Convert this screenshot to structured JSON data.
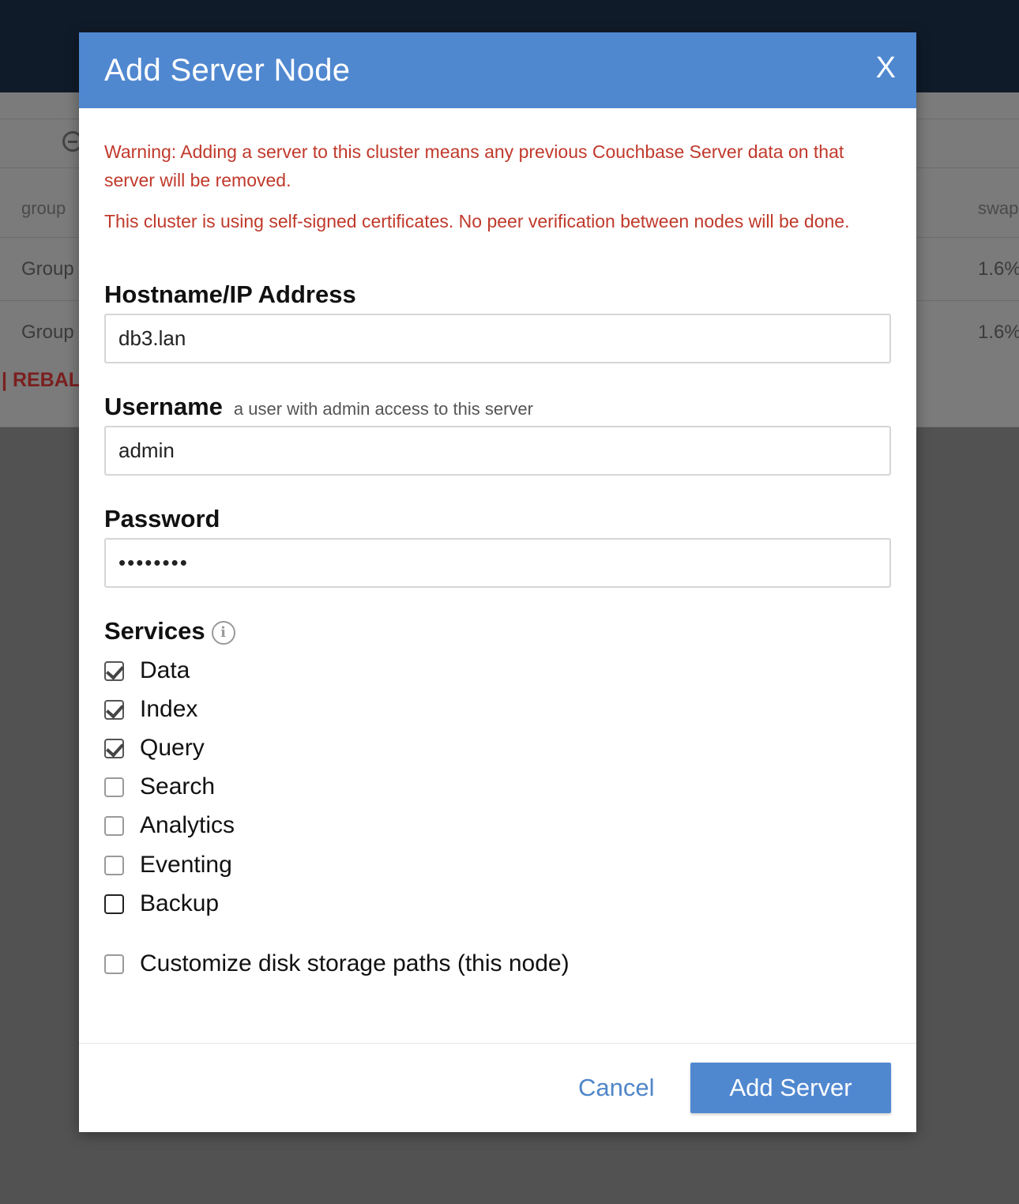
{
  "background": {
    "group_col_header": "group",
    "swap_col_header": "swap",
    "rows": [
      {
        "group": "Group",
        "swap": "1.6%"
      },
      {
        "group": "Group",
        "swap": "1.6%"
      }
    ],
    "rebalance_label": "| REBAL"
  },
  "modal": {
    "title": "Add Server Node",
    "close_label": "X",
    "warning_1": "Warning: Adding a server to this cluster means any previous Couchbase Server data on that server will be removed.",
    "warning_2": "This cluster is using self-signed certificates. No peer verification between nodes will be done.",
    "hostname": {
      "label": "Hostname/IP Address",
      "value": "db3.lan"
    },
    "username": {
      "label": "Username",
      "hint": "a user with admin access to this server",
      "value": "admin"
    },
    "password": {
      "label": "Password",
      "value": "••••••••"
    },
    "services": {
      "label": "Services",
      "info_icon": "info-icon",
      "items": [
        {
          "label": "Data",
          "checked": true
        },
        {
          "label": "Index",
          "checked": true
        },
        {
          "label": "Query",
          "checked": true
        },
        {
          "label": "Search",
          "checked": false
        },
        {
          "label": "Analytics",
          "checked": false
        },
        {
          "label": "Eventing",
          "checked": false
        },
        {
          "label": "Backup",
          "checked": false
        }
      ]
    },
    "customize_paths": {
      "label": "Customize disk storage paths (this node)",
      "checked": false
    },
    "cancel_label": "Cancel",
    "add_label": "Add Server"
  },
  "colors": {
    "header": "#5088d0",
    "warning": "#c0392b",
    "link": "#4f86c8",
    "topbar": "#101b29"
  }
}
